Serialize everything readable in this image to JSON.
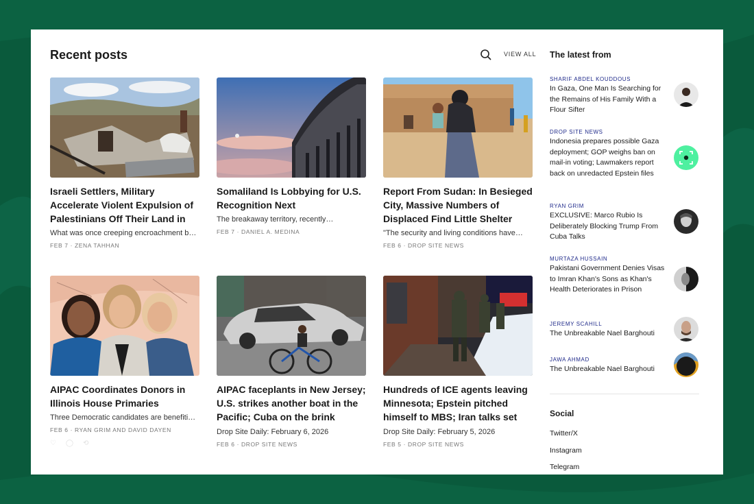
{
  "header": {
    "title": "Recent posts",
    "view_all": "VIEW ALL"
  },
  "posts": [
    {
      "title": "Israeli Settlers, Military Accelerate Violent Expulsion of Palestinians Off Their Land in t…",
      "excerpt": "What was once creeping encroachment b…",
      "meta": "FEB 7 · ZENA TAHHAN"
    },
    {
      "title": "Somaliland Is Lobbying for U.S. Recognition Next",
      "excerpt": "The breakaway territory, recently…",
      "meta": "FEB 7 · DANIEL A. MEDINA"
    },
    {
      "title": "Report From Sudan: In Besieged City, Massive Numbers of Displaced Find Little Shelter or…",
      "excerpt": "\"The security and living conditions have…",
      "meta": "FEB 6 · DROP SITE NEWS"
    },
    {
      "title": "AIPAC Coordinates Donors in Illinois House Primaries",
      "excerpt": "Three Democratic candidates are benefiti…",
      "meta": "FEB 6 · RYAN GRIM AND DAVID DAYEN"
    },
    {
      "title": "AIPAC faceplants in New Jersey; U.S. strikes another boat in the Pacific; Cuba on the brink",
      "subtitle": "Drop Site Daily: February 6, 2026",
      "meta": "FEB 6 · DROP SITE NEWS"
    },
    {
      "title": "Hundreds of ICE agents leaving Minnesota; Epstein pitched himself to MBS; Iran talks set fo…",
      "subtitle": "Drop Site Daily: February 5, 2026",
      "meta": "FEB 5 · DROP SITE NEWS"
    }
  ],
  "sidebar": {
    "title": "The latest from",
    "items": [
      {
        "author": "SHARIF ABDEL KOUDDOUS",
        "title": "In Gaza, One Man Is Searching for the Remains of His Family With a Flour Sifter"
      },
      {
        "author": "DROP SITE NEWS",
        "title": "Indonesia prepares possible Gaza deployment; GOP weighs ban on mail-in voting; Lawmakers report back on unredacted Epstein files"
      },
      {
        "author": "RYAN GRIM",
        "title": "EXCLUSIVE: Marco Rubio Is Deliberately Blocking Trump From Cuba Talks"
      },
      {
        "author": "MURTAZA HUSSAIN",
        "title": "Pakistani Government Denies Visas to Imran Khan's Sons as Khan's Health Deteriorates in Prison"
      },
      {
        "author": "JEREMY SCAHILL",
        "title": "The Unbreakable Nael Barghouti"
      },
      {
        "author": "JAWA AHMAD",
        "title": "The Unbreakable Nael Barghouti"
      }
    ],
    "social_title": "Social",
    "social_links": [
      "Twitter/X",
      "Instagram",
      "Telegram"
    ]
  },
  "colors": {
    "background": "#0a5a3c",
    "author_blue": "#1f2a8a",
    "accent_green": "#4ef0a0"
  }
}
